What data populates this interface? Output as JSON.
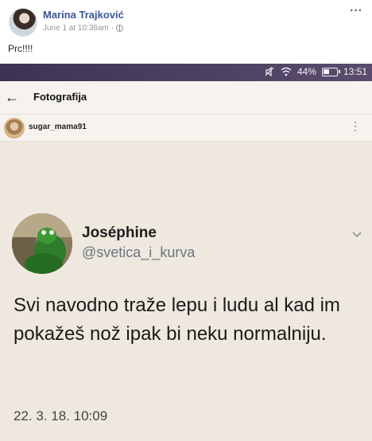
{
  "post": {
    "author": "Marina Trajković",
    "timestamp": "June 1 at 10:36am",
    "separator": "·",
    "more_label": "···",
    "text": "Prc!!!!"
  },
  "screenshot": {
    "status_bar": {
      "battery": "44%",
      "battery_level": 0.44,
      "time": "13:51"
    },
    "app_bar": {
      "title": "Fotografija"
    },
    "user": {
      "username": "sugar_mama91",
      "more_label": "⋮"
    },
    "tweet": {
      "display_name": "Joséphine",
      "handle": "@svetica_i_kurva",
      "text": "Svi navodno traže lepu i ludu al kad im pokažeš nož ipak bi neku normalniju.",
      "date": "22. 3. 18. 10:09"
    }
  },
  "icons": {
    "globe": "globe-icon",
    "mute": "mute-icon",
    "wifi": "wifi-icon",
    "battery": "battery-icon",
    "back": "back-arrow-icon",
    "chevron": "chevron-down-icon"
  },
  "colors": {
    "author_link": "#385898",
    "status_bar": "#3c3352",
    "tweet_background": "#efe8df",
    "handle": "#697580"
  }
}
